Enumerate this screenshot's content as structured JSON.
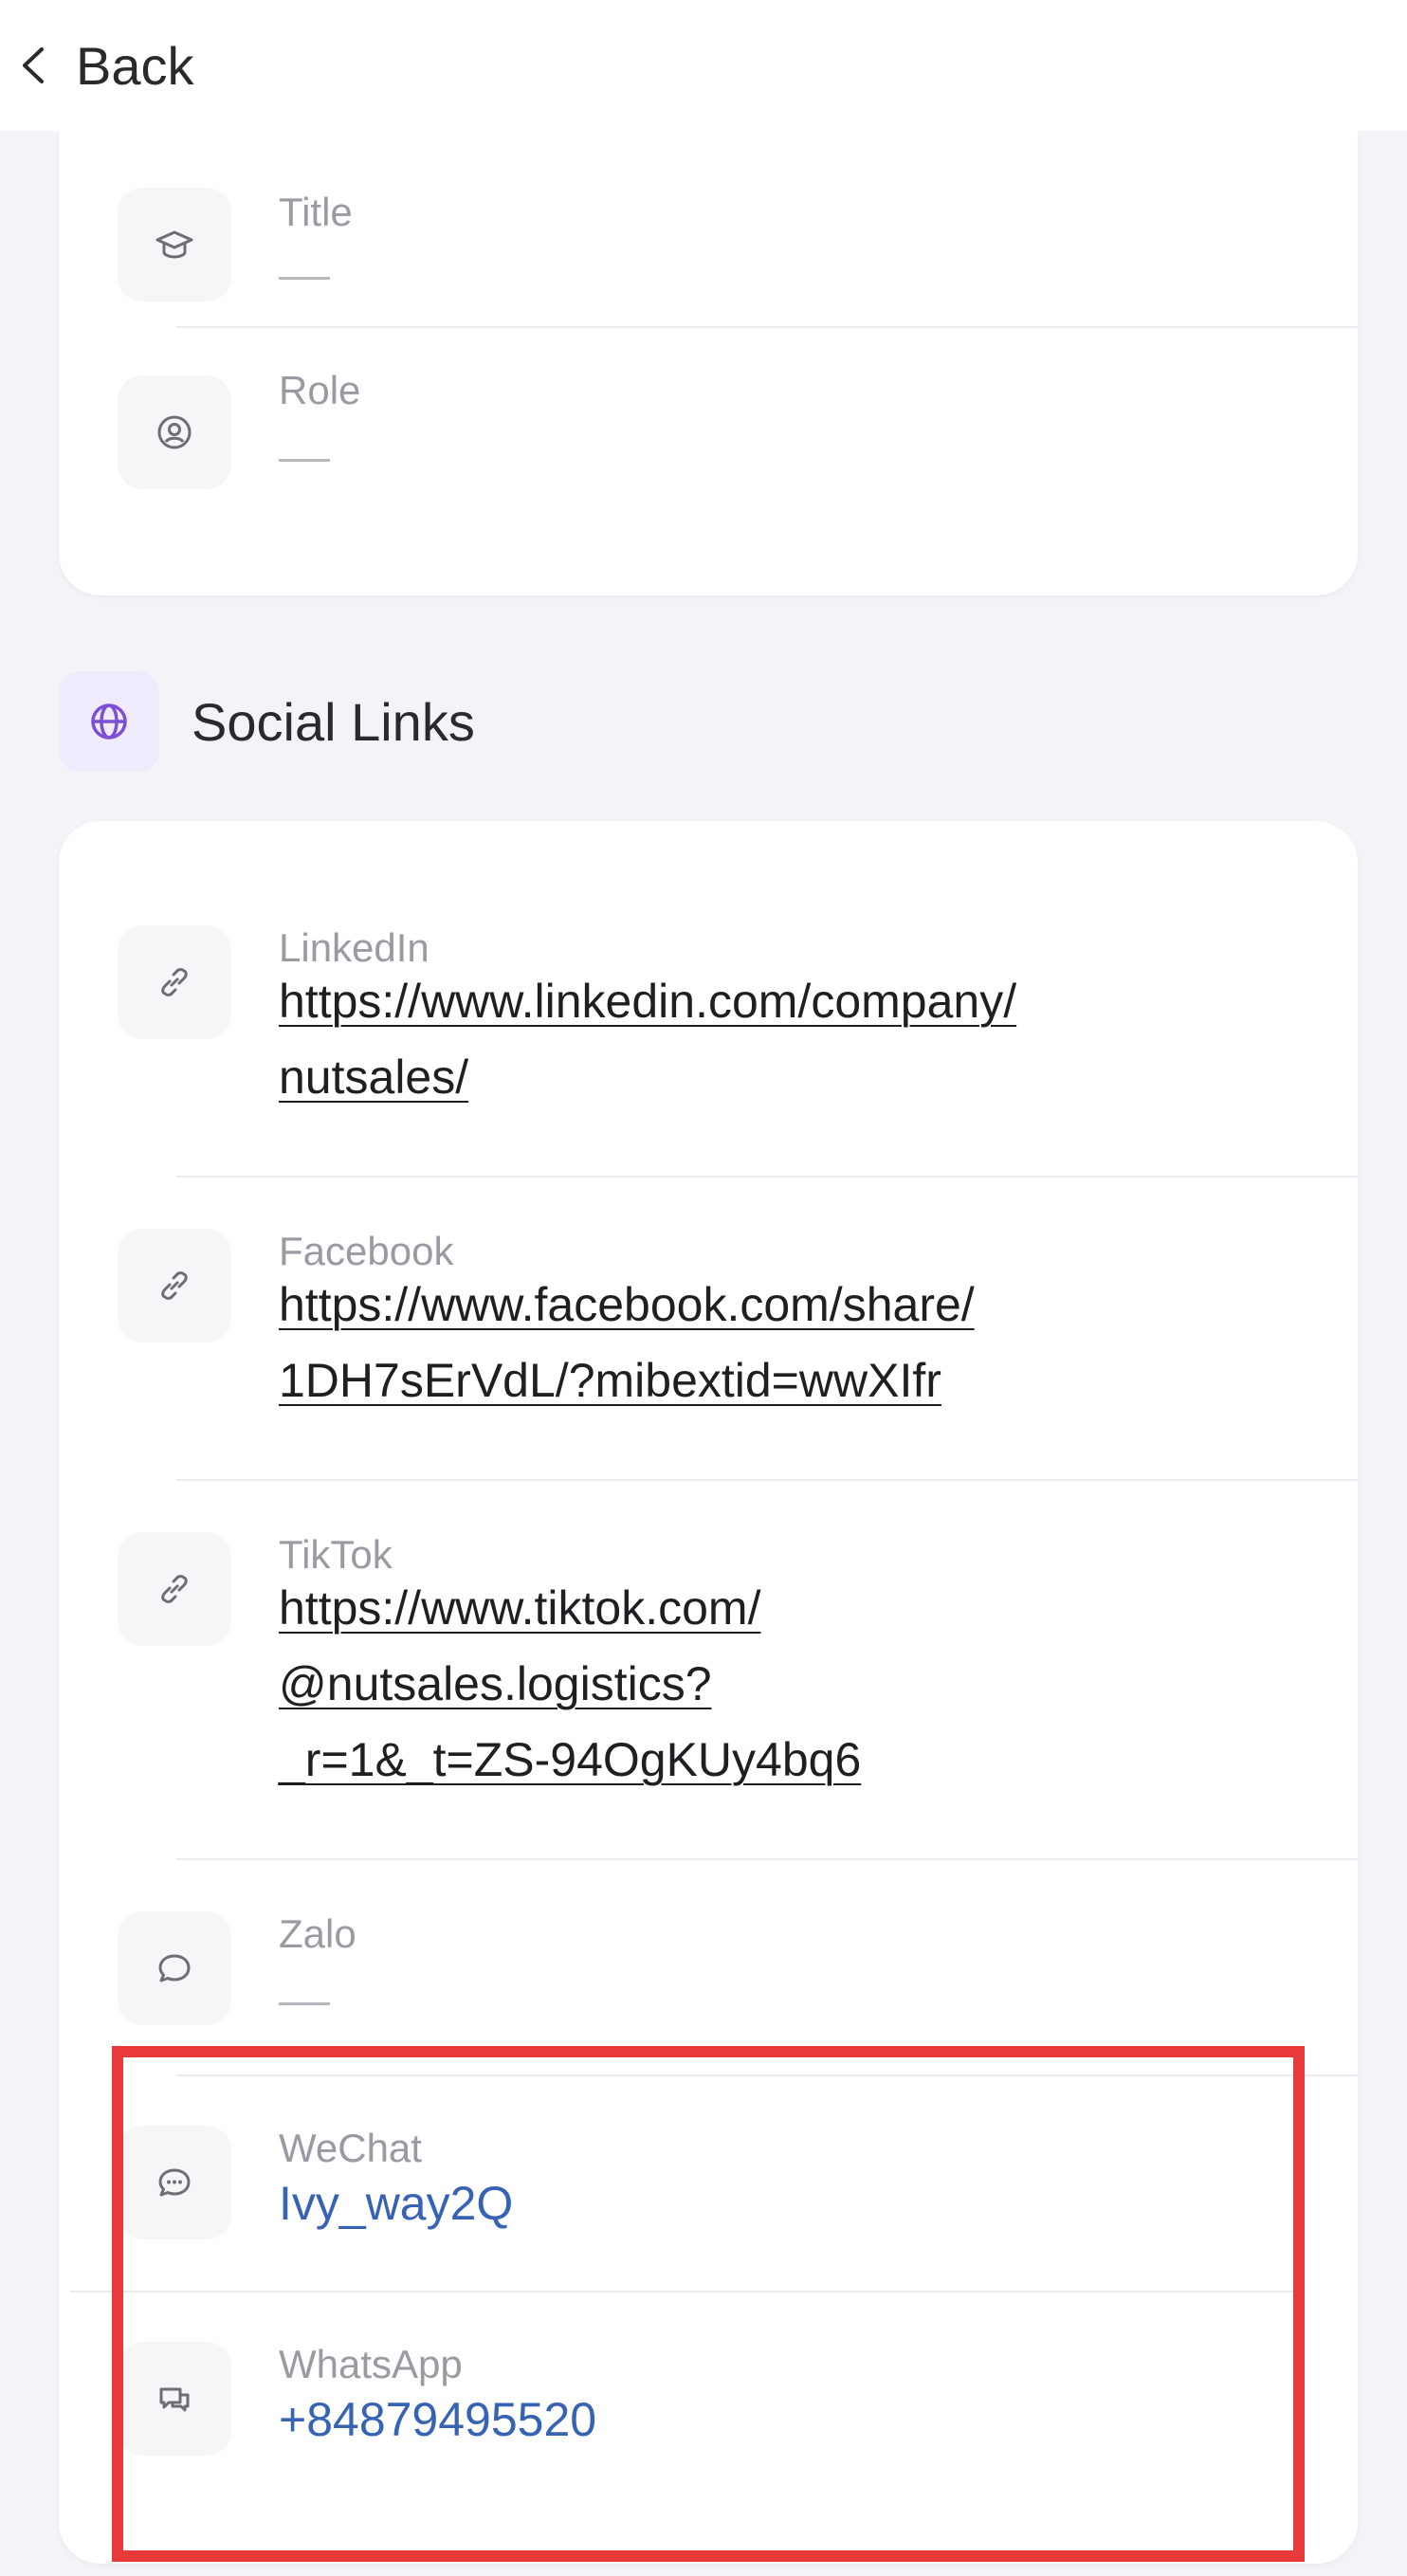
{
  "header": {
    "back_label": "Back"
  },
  "profile": {
    "title": {
      "label": "Title",
      "value": "—"
    },
    "role": {
      "label": "Role",
      "value": "—"
    }
  },
  "social": {
    "section_title": "Social Links",
    "items": [
      {
        "label": "LinkedIn",
        "value_lines": [
          "https://www.linkedin.com/company/",
          "nutsales/"
        ],
        "icon": "link-icon"
      },
      {
        "label": "Facebook",
        "value_lines": [
          "https://www.facebook.com/share/",
          "1DH7sErVdL/?mibextid=wwXIfr"
        ],
        "icon": "link-icon"
      },
      {
        "label": "TikTok",
        "value_lines": [
          "https://www.tiktok.com/",
          "@nutsales.logistics?",
          "_r=1&_t=ZS-94OgKUy4bq6"
        ],
        "icon": "link-icon"
      },
      {
        "label": "Zalo",
        "value": "—",
        "icon": "chat-bubble-icon"
      },
      {
        "label": "WeChat",
        "value": "Ivy_way2Q",
        "icon": "wechat-icon"
      },
      {
        "label": "WhatsApp",
        "value": "+84879495520",
        "icon": "whatsapp-icon"
      }
    ]
  },
  "colors": {
    "accent_blue": "#3763b5",
    "highlight_red": "#e8393b",
    "section_icon_bg": "#efeafc"
  }
}
